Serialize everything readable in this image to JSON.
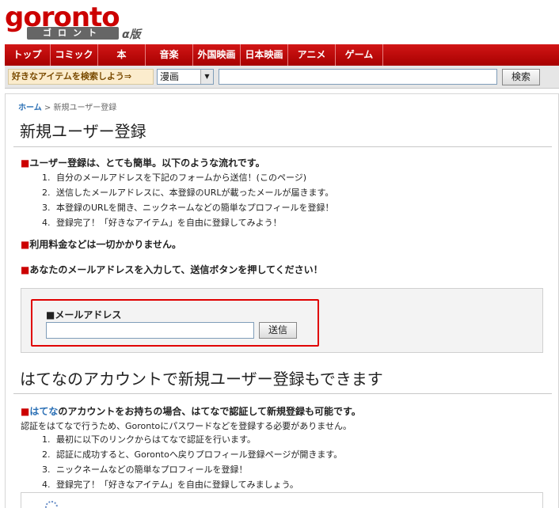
{
  "logo": {
    "main": "goronto",
    "sub": "ゴロント",
    "badge": "α版"
  },
  "nav": [
    "トップ",
    "コミック",
    "本",
    "音楽",
    "外国映画",
    "日本映画",
    "アニメ",
    "ゲーム"
  ],
  "search": {
    "label": "好きなアイテムを検索しよう⇒",
    "category": "漫画",
    "query": "",
    "button": "検索"
  },
  "breadcrumb": {
    "home": "ホーム",
    "sep": ">",
    "current": "新規ユーザー登録"
  },
  "page_title": "新規ユーザー登録",
  "intro": {
    "heading": "ユーザー登録は、とても簡単。以下のような流れです。",
    "steps": [
      {
        "num": "1.",
        "text": "自分のメールアドレスを下記のフォームから送信！(このページ)"
      },
      {
        "num": "2.",
        "text": "送信したメールアドレスに、本登録のURLが載ったメールが届きます。"
      },
      {
        "num": "3.",
        "text": "本登録のURLを開き、ニックネームなどの簡単なプロフィールを登録！"
      },
      {
        "num": "4.",
        "text": "登録完了！「好きなアイテム」を自由に登録してみよう！"
      }
    ]
  },
  "fee_text": "利用料金などは一切かかりません。",
  "instruction_text": "あなたのメールアドレスを入力して、送信ボタンを押してください！",
  "form": {
    "email_label": "■メールアドレス",
    "email_value": "",
    "send_button": "送信"
  },
  "hatena": {
    "title": "はてなのアカウントで新規ユーザー登録もできます",
    "heading_link": "はてな",
    "heading_rest": "のアカウントをお持ちの場合、はてなで認証して新規登録も可能です。",
    "note": "認証をはてなで行うため、Gorontoにパスワードなどを登録する必要がありません。",
    "steps": [
      {
        "num": "1.",
        "text": "最初に以下のリンクからはてなで認証を行います。"
      },
      {
        "num": "2.",
        "text": "認証に成功すると、Gorontoへ戻りプロフィール登録ページが開きます。"
      },
      {
        "num": "3.",
        "text": "ニックネームなどの簡単なプロフィールを登録！"
      },
      {
        "num": "4.",
        "text": "登録完了！「好きなアイテム」を自由に登録してみましょう。"
      }
    ]
  },
  "colors": {
    "brand_red": "#cc0000",
    "link_blue": "#2a6fb5",
    "highlight_border": "#e00000"
  }
}
